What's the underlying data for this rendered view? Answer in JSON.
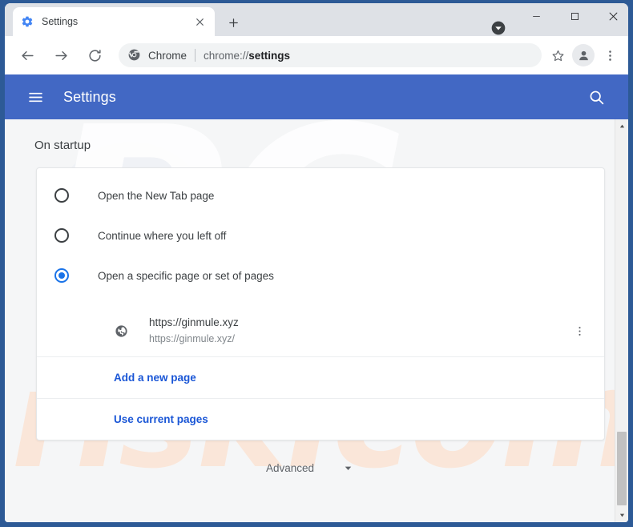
{
  "window": {
    "frame_color": "#2d5a96",
    "controls": {
      "minimize": "minimize-icon",
      "maximize": "maximize-icon",
      "close": "close-icon"
    },
    "download_indicator": "download-arrow-icon"
  },
  "tab": {
    "title": "Settings",
    "favicon": "gear-icon",
    "close_label": "close-tab-icon",
    "new_tab_label": "new-tab-plus-icon"
  },
  "toolbar": {
    "back": "back-arrow-icon",
    "forward": "forward-arrow-icon",
    "reload": "reload-icon",
    "omnibox": {
      "icon": "chrome-logo-icon",
      "scheme_label": "Chrome",
      "url_prefix": "chrome://",
      "url_bold": "settings",
      "full_url": "chrome://settings"
    },
    "bookmark": "star-icon",
    "profile": "avatar-person-icon",
    "menu": "three-dot-menu-icon"
  },
  "settings_header": {
    "menu_icon": "hamburger-icon",
    "title": "Settings",
    "search_icon": "search-icon",
    "background_color": "#4268c4"
  },
  "content": {
    "section_title": "On startup",
    "startup_options": [
      {
        "label": "Open the New Tab page",
        "selected": false
      },
      {
        "label": "Continue where you left off",
        "selected": false
      },
      {
        "label": "Open a specific page or set of pages",
        "selected": true
      }
    ],
    "startup_pages": [
      {
        "favicon": "globe-icon",
        "title": "https://ginmule.xyz",
        "url": "https://ginmule.xyz/",
        "more_icon": "three-dot-menu-icon"
      }
    ],
    "actions": [
      {
        "label": "Add a new page"
      },
      {
        "label": "Use current pages"
      }
    ],
    "advanced": {
      "label": "Advanced",
      "chevron": "chevron-down-icon"
    },
    "accent_color": "#1a73e8",
    "link_color": "#1a56d6"
  },
  "watermark": {
    "primary_text": "PC",
    "secondary_text": "risk.com"
  },
  "scrollbar": {
    "up_arrow": "scroll-up-icon",
    "down_arrow": "scroll-down-icon"
  }
}
